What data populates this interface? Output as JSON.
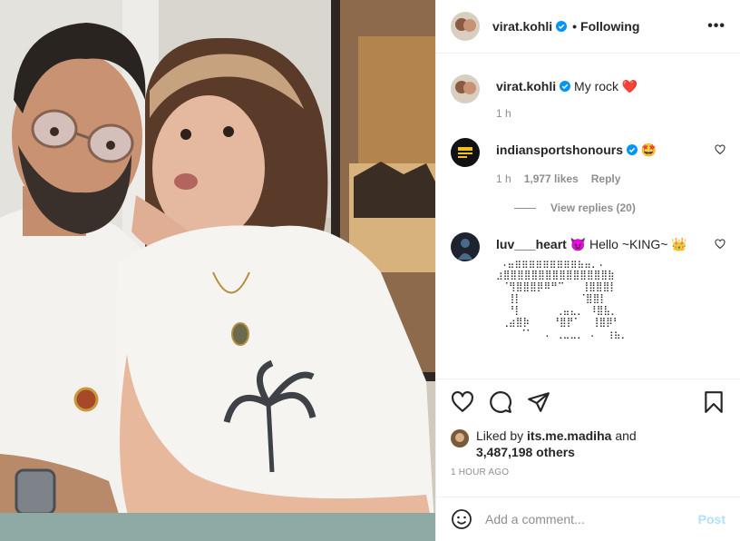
{
  "post": {
    "username": "virat.kohli",
    "follow_status": "Following",
    "separator": "•",
    "more_label": "•••"
  },
  "caption": {
    "username": "virat.kohli",
    "text": "My rock",
    "emoji": "❤️",
    "age": "1 h"
  },
  "comments": [
    {
      "username": "indiansportshonours",
      "text": "🤩",
      "age": "1 h",
      "likes": "1,977 likes",
      "reply_label": "Reply",
      "view_replies": "View replies (20)"
    },
    {
      "username": "luv___heart",
      "text": "😈 Hello ~KING~ 👑",
      "ascii_art": " .⣤⣶⣶⣶⣶⣶⣶⣶⣶⣶⣦⣤⡀.\n⣰⣿⣿⣿⣿⣿⣿⣿⣿⣿⣿⣿⣿⣿⣿⣿⣷\n ⠈⢻⣿⣿⣿⡿⠿⠛⠉   ⢸⣿⣿⣿⡇\n  ⢸⡇          ⠈⣿⣿⡇\n  ⠘⡇      ⢀⣤⣄⡀ ⠸⣿⣧⡀\n ⢀⣴⣿⡷    ⠘⣿⡟⠁  ⢸⣿⡿⠃\n    ⠈⠁  . ⢀⣀⣀⡀ .  ⢰⣦⡀"
    }
  ],
  "likes": {
    "liked_by_prefix": "Liked by",
    "liked_by_user": "its.me.madiha",
    "and": "and",
    "others": "3,487,198 others"
  },
  "timestamp": "1 HOUR AGO",
  "comment_box": {
    "placeholder": "Add a comment...",
    "post_label": "Post"
  },
  "colors": {
    "verified": "#0095f6",
    "heart": "#ed4956",
    "post_disabled": "#b2dffc",
    "secondary_text": "#8e8e8e"
  },
  "icons": [
    "verified-badge-icon",
    "heart-icon",
    "comment-icon",
    "share-icon",
    "bookmark-icon",
    "emoji-icon"
  ]
}
